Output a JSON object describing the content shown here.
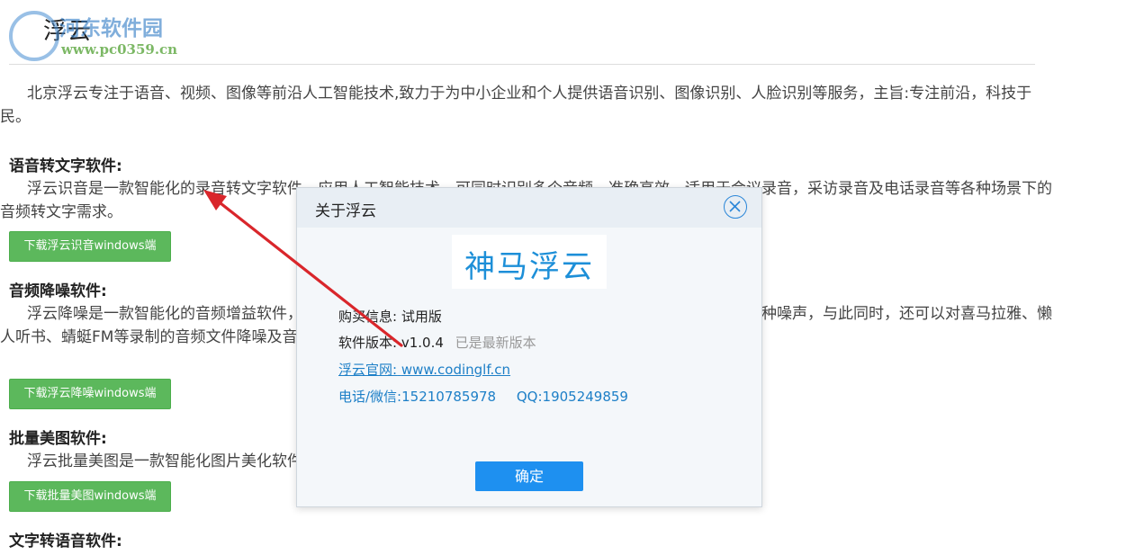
{
  "page": {
    "title": "浮云",
    "watermark_text": "河东软件园",
    "watermark_url": "www.pc0359.cn",
    "intro": "北京浮云专注于语音、视频、图像等前沿人工智能技术,致力于为中小企业和个人提供语音识别、图像识别、人脸识别等服务，主旨:专注前沿，科技于民。"
  },
  "sections": [
    {
      "heading": "语音转文字软件:",
      "text": "浮云识音是一款智能化的录音转文字软件，应用人工智能技术，可同时识别多个音频，准确高效，适用于会议录音，采访录音及电话录音等各种场景下的音频转文字需求。",
      "button": "下载浮云识音windows端"
    },
    {
      "heading": "音频降噪软件:",
      "text": "浮云降噪是一款智能化的音频增益软件，应用人工智能算法，可以极大消除音频中的风声、水声、电流声等多种噪声，与此同时，还可以对喜马拉雅、懒人听书、蜻蜓FM等录制的音频文件降噪及音频文件调高音量等场景。",
      "button": "下载浮云降噪windows端"
    },
    {
      "heading": "批量美图软件:",
      "text": "浮云批量美图是一款智能化图片美化软件，一键美图，批量美图尽在浮云批量美图。",
      "button": "下载批量美图windows端"
    },
    {
      "heading": "文字转语音软件:"
    }
  ],
  "dialog": {
    "title": "关于浮云",
    "logo_text": "神马浮云",
    "purchase_label": "购买信息:",
    "purchase_value": "试用版",
    "version_label": "软件版本:",
    "version_value": "v1.0.4",
    "version_status": "已是最新版本",
    "site_label": "浮云官网:",
    "site_value": "www.codinglf.cn",
    "phone": "电话/微信:15210785978",
    "qq": "QQ:1905249859",
    "ok_label": "确定"
  },
  "colors": {
    "download_button": "#5cb85c",
    "ok_button": "#1e90f0",
    "link": "#1d7fc7",
    "arrow": "#d9262b"
  }
}
